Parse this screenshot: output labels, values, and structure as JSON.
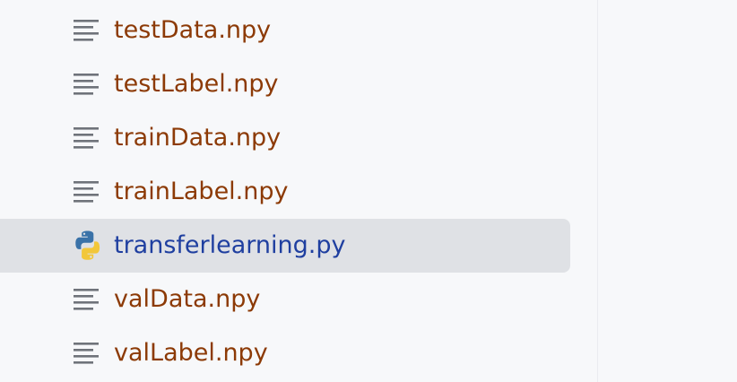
{
  "colors": {
    "file_text": "#8c3a06",
    "selected_text": "#1f3fa0",
    "lines_icon": "#6f737a",
    "python_blue": "#3a72a8",
    "python_yellow": "#f2c73a"
  },
  "files": [
    {
      "name": "testData.npy",
      "icon": "text-lines-icon"
    },
    {
      "name": "testLabel.npy",
      "icon": "text-lines-icon"
    },
    {
      "name": "trainData.npy",
      "icon": "text-lines-icon"
    },
    {
      "name": "trainLabel.npy",
      "icon": "text-lines-icon"
    },
    {
      "name": "transferlearning.py",
      "icon": "python-icon",
      "selected": true
    },
    {
      "name": "valData.npy",
      "icon": "text-lines-icon"
    },
    {
      "name": "valLabel.npy",
      "icon": "text-lines-icon"
    }
  ]
}
